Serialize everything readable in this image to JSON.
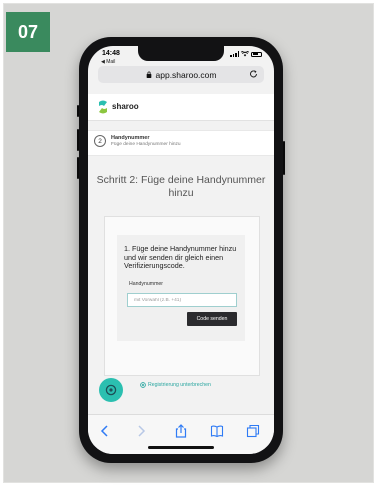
{
  "figure": {
    "step_number": "07"
  },
  "status_bar": {
    "time": "14:48",
    "back_app": "◀ Mail"
  },
  "browser": {
    "url": "app.sharoo.com"
  },
  "site": {
    "brand": "sharoo"
  },
  "progress": {
    "step": "2",
    "title": "Handynummer",
    "subtitle": "Füge deine Handynummer hinzu"
  },
  "main": {
    "heading": "Schritt 2: Füge deine Handynummer hinzu",
    "instruction": "1. Füge deine Handynummer hinzu und wir senden dir gleich einen Verifizierungscode.",
    "field_label": "Handynummer",
    "field_placeholder": "mit Vorwahl (z.B. +41)",
    "field_value": "",
    "send_button": "Code senden"
  },
  "footer": {
    "cancel_link": "Registrierung unterbrechen"
  },
  "icons": {
    "help": "help-icon",
    "cancel": "cancel-circle-icon",
    "back": "chevron-left-icon",
    "forward": "chevron-right-icon",
    "share": "share-icon",
    "bookmarks": "book-icon",
    "tabs": "tabs-icon"
  },
  "colors": {
    "badge": "#3a8a5e",
    "accent": "#2bbfb0",
    "button": "#2b2b2e"
  }
}
